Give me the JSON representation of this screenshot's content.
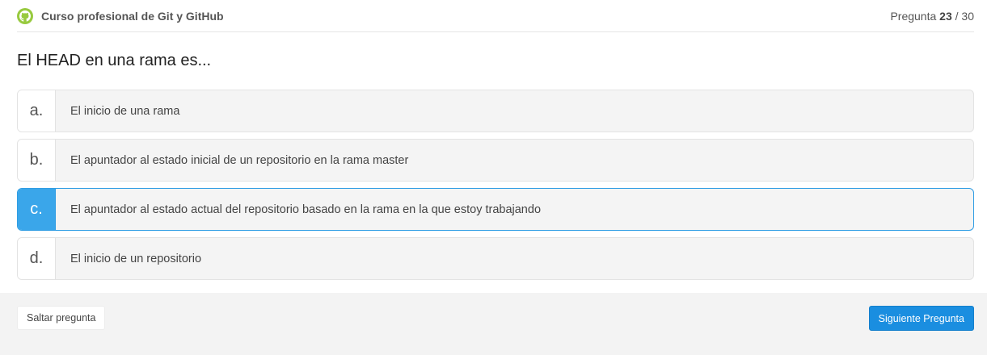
{
  "header": {
    "course_title": "Curso profesional de Git y GitHub",
    "logo_icon": "github-octocat-icon",
    "logo_color": "#98ca3f",
    "counter_prefix": "Pregunta",
    "current_question": "23",
    "counter_separator": "/",
    "total_questions": "30"
  },
  "question": {
    "text": "El HEAD en una rama es..."
  },
  "options": [
    {
      "letter": "a.",
      "text": "El inicio de una rama",
      "selected": false
    },
    {
      "letter": "b.",
      "text": "El apuntador al estado inicial de un repositorio en la rama master",
      "selected": false
    },
    {
      "letter": "c.",
      "text": "El apuntador al estado actual del repositorio basado en la rama en la que estoy trabajando",
      "selected": true
    },
    {
      "letter": "d.",
      "text": "El inicio de un repositorio",
      "selected": false
    }
  ],
  "footer": {
    "skip_label": "Saltar pregunta",
    "next_label": "Siguiente Pregunta"
  },
  "colors": {
    "accent": "#3aa6ea",
    "button_primary": "#1a8ee0"
  }
}
